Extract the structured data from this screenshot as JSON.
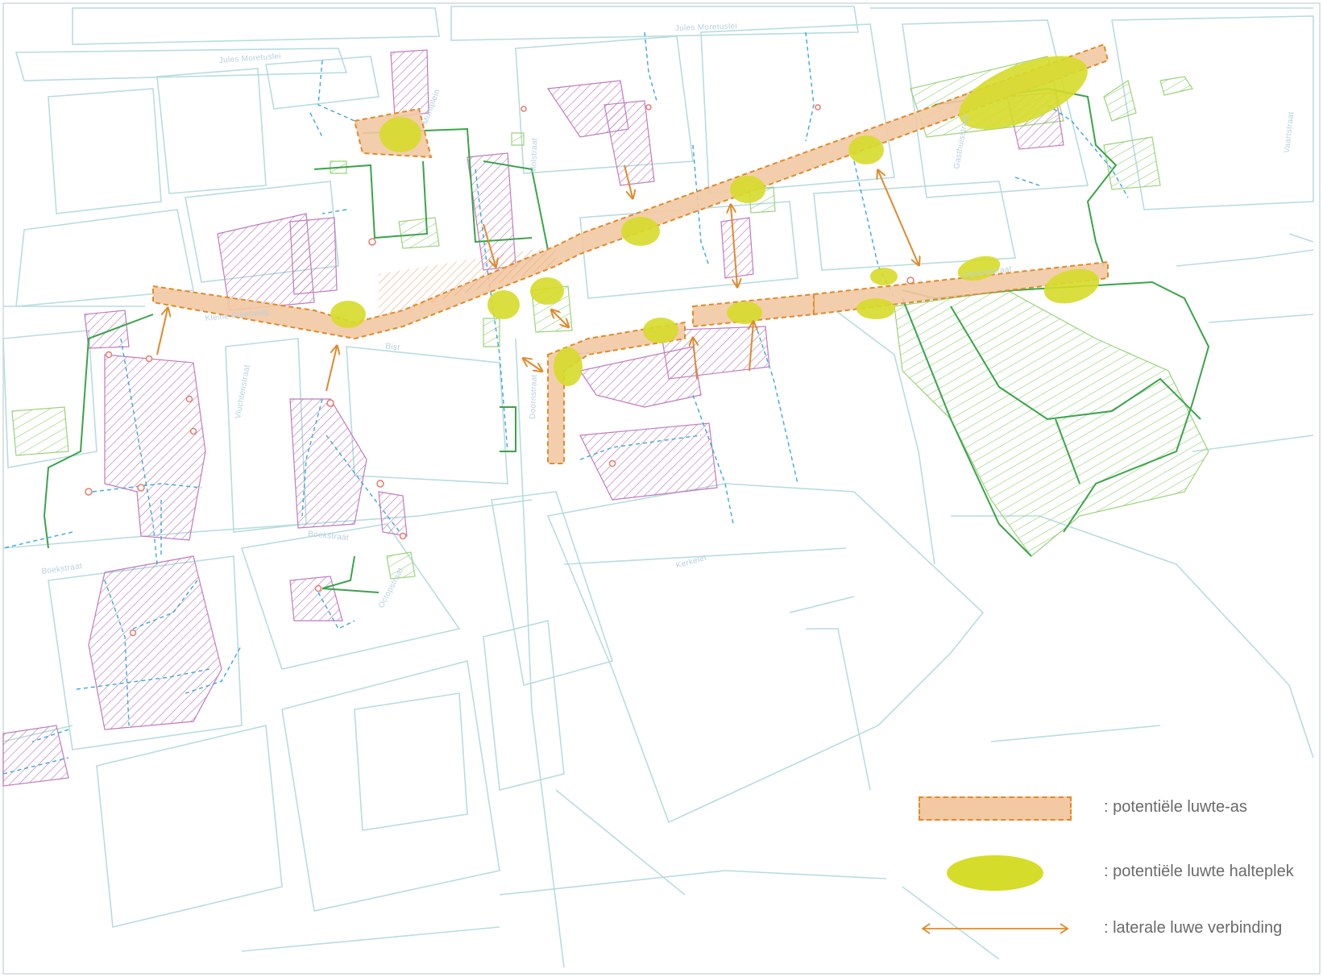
{
  "map": {
    "streets": {
      "jules_moretuslei_top": "Jules Moretuslei",
      "jules_moretuslei_left": "Jules Moretuslei",
      "kleine_steenweg": "Kleine Steenweg",
      "bist": "Bist",
      "boekstraat_left": "Boekstraat",
      "boekstraat_mid": "Boekstraat",
      "vluchtenstraat": "Vluchtenstraat",
      "doornstraat": "Doornstraat",
      "kerkelei": "Kerkelei",
      "molstraat": "Molstraat",
      "muntplein": "Muntplein",
      "octopstraat": "Octopstraat",
      "gasthuisstraat": "Gasthuisstraat",
      "vaartstraat": "Vaartstraat",
      "ijzerenstraat": "IJzerenstraat"
    },
    "colors": {
      "street": "#b8dcdf",
      "axis_fill": "#f2c9a3",
      "axis_border": "#e08a2a",
      "stop": "#d6dc2a",
      "lateral": "#e08a2a",
      "building_hatch": "#c07ac0",
      "green_path": "#3aa44a",
      "green_area": "#9bd27a",
      "blue_dashed": "#3aa7e0",
      "point": "#e87a6a"
    }
  },
  "legend": {
    "axis_label": ": potentiële luwte-as",
    "stop_label": ": potentiële luwte halteplek",
    "lateral_label": ": laterale luwe verbinding"
  }
}
